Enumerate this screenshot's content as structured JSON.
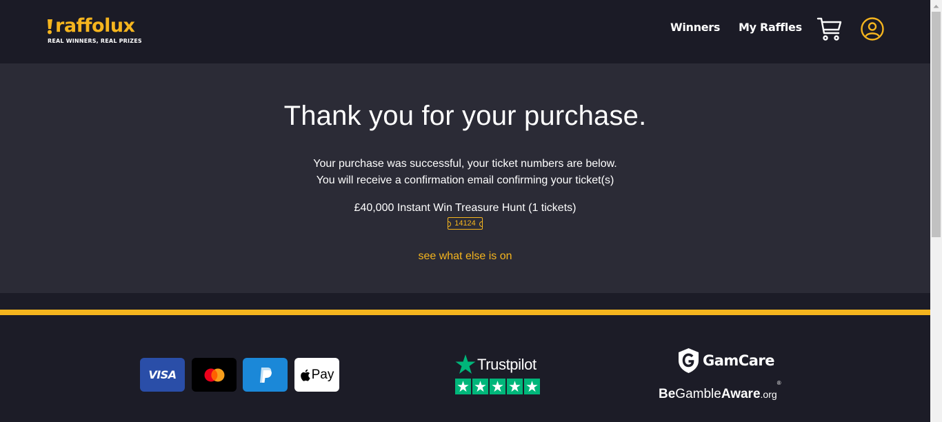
{
  "header": {
    "logo_text": "raffolux",
    "logo_tagline": "REAL WINNERS, REAL PRIZES",
    "nav": {
      "winners": "Winners",
      "my_raffles": "My Raffles"
    }
  },
  "main": {
    "title": "Thank you for your purchase.",
    "message_line1": "Your purchase was successful, your ticket numbers are below.",
    "message_line2": "You will receive a confirmation email confirming your ticket(s)",
    "raffle_name": "£40,000 Instant Win Treasure Hunt (1 tickets)",
    "ticket_number": "14124",
    "see_more_link": "see what else is on"
  },
  "footer": {
    "payment": {
      "visa": "VISA",
      "apple_pay": "Pay"
    },
    "trustpilot": "Trustpilot",
    "gamcare": "GamCare",
    "begambleaware": {
      "be": "Be",
      "gamble": "Gamble",
      "aware": "Aware",
      "org": ".org",
      "reg": "®"
    }
  },
  "colors": {
    "accent": "#f5b51e",
    "header_bg": "#1b1b26",
    "main_bg": "#2b2b36",
    "trustpilot_green": "#00b67a",
    "visa_blue": "#2a4ea8",
    "paypal_blue": "#1b88d8"
  },
  "icons": {
    "cart": "shopping-cart-icon",
    "account": "user-circle-icon"
  }
}
